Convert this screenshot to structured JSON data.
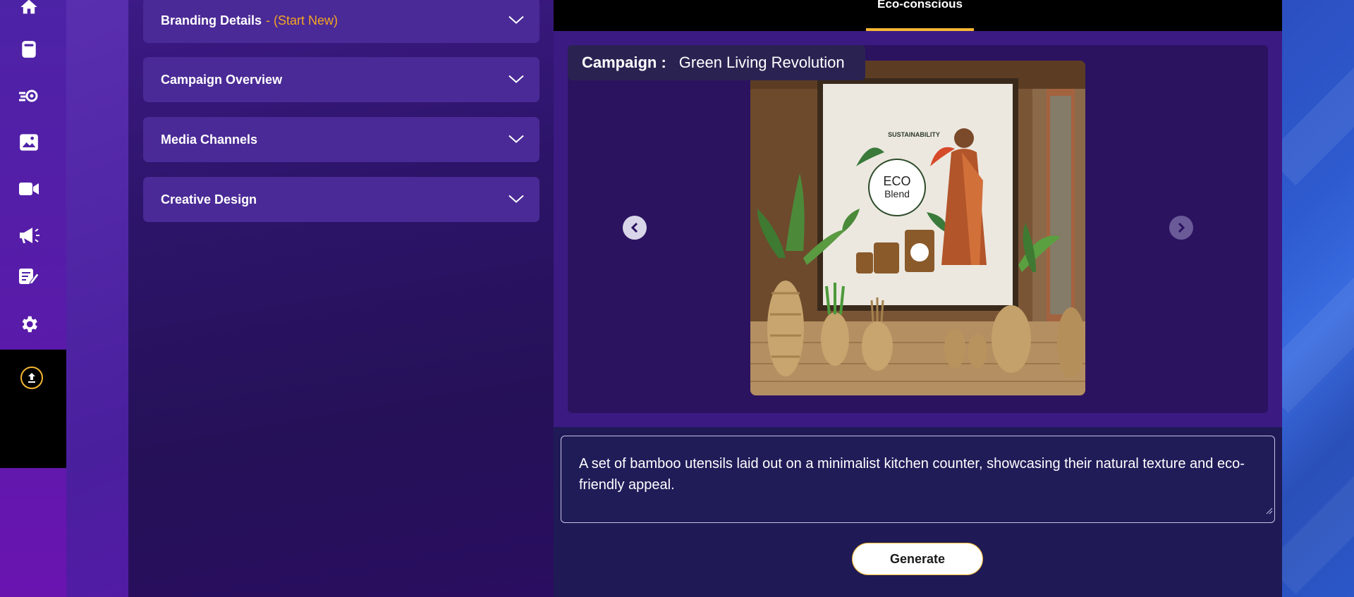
{
  "sidebar": {
    "icons": [
      "home-icon",
      "book-icon",
      "gear-run-icon",
      "image-icon",
      "video-icon",
      "megaphone-icon",
      "feedback-icon",
      "settings-icon"
    ],
    "upload_icon": "upload-icon"
  },
  "accordion": {
    "items": [
      {
        "label": "Branding Details",
        "hint": "- (Start New)"
      },
      {
        "label": "Campaign Overview",
        "hint": ""
      },
      {
        "label": "Media Channels",
        "hint": ""
      },
      {
        "label": "Creative Design",
        "hint": ""
      }
    ]
  },
  "tabs": {
    "active": "Eco-conscious"
  },
  "carousel": {
    "campaign_key": "Campaign :",
    "campaign_value": "Green Living Revolution",
    "poster": {
      "brand_top": "SUSTAINABILITY",
      "logo_line1": "ECO",
      "logo_line2": "Blend"
    }
  },
  "prompt": {
    "value": "A set of bamboo utensils laid out on a minimalist kitchen counter, showcasing their natural texture and eco-friendly appeal."
  },
  "actions": {
    "generate_label": "Generate"
  },
  "colors": {
    "accent": "#f5b731",
    "hint": "#f5a623",
    "panel": "#4a2a96",
    "main_bg": "#1f1a55"
  }
}
